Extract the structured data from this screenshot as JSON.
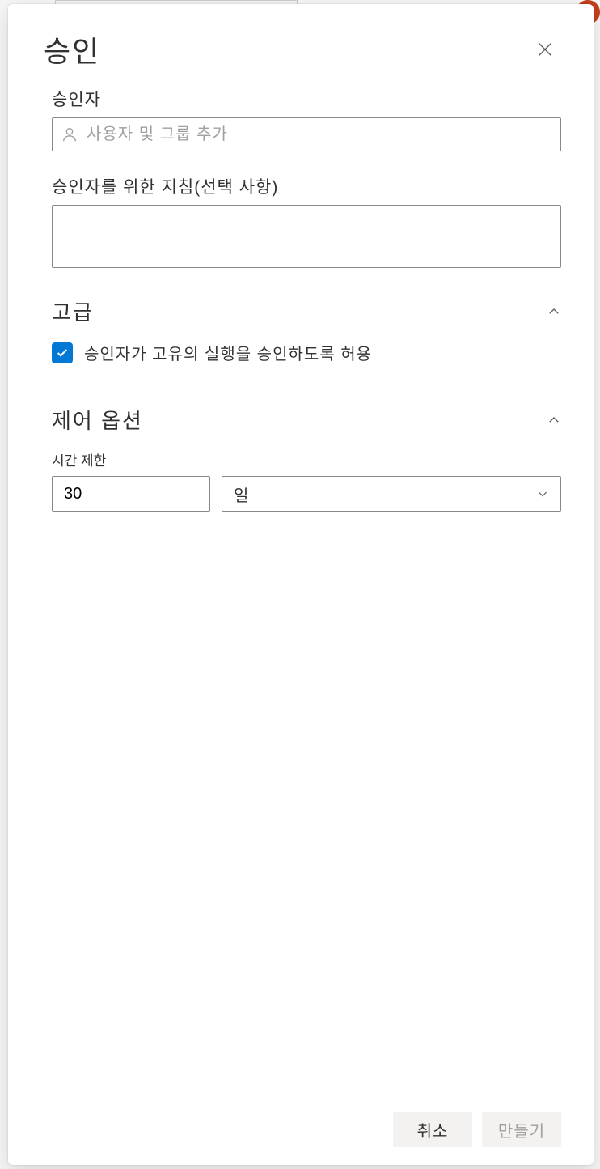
{
  "panel": {
    "title": "승인",
    "approvers": {
      "label": "승인자",
      "placeholder": "사용자 및 그룹 추가"
    },
    "instructions": {
      "label": "승인자를 위한 지침(선택 사항)"
    },
    "advanced": {
      "title": "고급",
      "allow_self_approve": "승인자가 고유의 실행을 승인하도록 허용"
    },
    "control_options": {
      "title": "제어 옵션",
      "timeout_label": "시간 제한",
      "timeout_value": "30",
      "timeout_unit": "일"
    },
    "footer": {
      "cancel": "취소",
      "create": "만들기"
    }
  }
}
